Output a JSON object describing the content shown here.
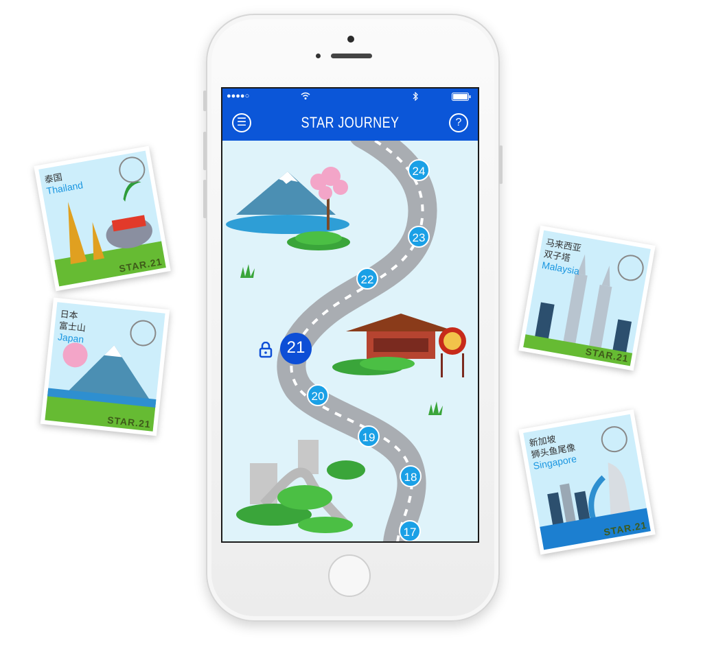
{
  "app": {
    "title": "STAR JOURNEY"
  },
  "statusbar": {
    "signal": "●●●●○",
    "wifi_icon": "wifi-icon",
    "bluetooth_icon": "bluetooth-icon",
    "battery_icon": "battery-icon"
  },
  "navbar": {
    "menu_glyph": "☰",
    "help_glyph": "?"
  },
  "levels": {
    "current": "21",
    "items": [
      "24",
      "23",
      "22",
      "21",
      "20",
      "19",
      "18",
      "17"
    ]
  },
  "stamps": [
    {
      "zh": "泰国",
      "en": "Thailand",
      "brand": "STAR.21"
    },
    {
      "zh": "日本\n富士山",
      "zh1": "日本",
      "zh2": "富士山",
      "en": "Japan",
      "brand": "STAR.21"
    },
    {
      "zh1": "马来西亚",
      "zh2": "双子塔",
      "en": "Malaysia",
      "brand": "STAR.21"
    },
    {
      "zh1": "新加坡",
      "zh2": "狮头鱼尾像",
      "en": "Singapore",
      "brand": "STAR.21"
    }
  ],
  "colors": {
    "nav": "#0b56d8",
    "node": "#1aa0e6",
    "current": "#0d4ed6",
    "sky": "#dff3fa"
  }
}
